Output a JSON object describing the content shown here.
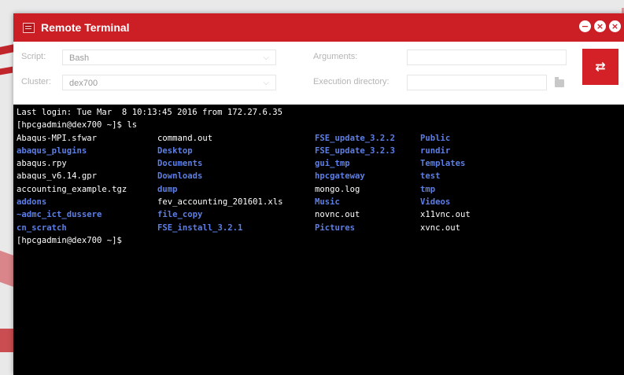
{
  "window": {
    "title": "Remote Terminal",
    "controls": [
      "−",
      "×",
      "×"
    ]
  },
  "form": {
    "script_label": "Script:",
    "script_value": "Bash",
    "cluster_label": "Cluster:",
    "cluster_value": "dex700",
    "arguments_label": "Arguments:",
    "arguments_value": "",
    "execdir_label": "Execution directory:",
    "execdir_value": "",
    "run_icon": "⇄"
  },
  "colors": {
    "accent": "#cc1f25",
    "directory": "#5d7fe5",
    "archive": "#e02b2b"
  },
  "terminal": {
    "last_login": "Last login: Tue Mar  8 10:13:45 2016 from 172.27.6.35",
    "prompt_cmd": "[hpcgadmin@dex700 ~]$ ls",
    "prompt_end": "[hpcgadmin@dex700 ~]$ ",
    "ls_rows": [
      [
        {
          "name": "Abaqus-MPI.sfwar",
          "type": "file"
        },
        {
          "name": "command.out",
          "type": "file"
        },
        {
          "name": "FSE_update_3.2.2",
          "type": "dir"
        },
        {
          "name": "Public",
          "type": "dir"
        }
      ],
      [
        {
          "name": "abaqus_plugins",
          "type": "dir"
        },
        {
          "name": "Desktop",
          "type": "dir"
        },
        {
          "name": "FSE_update_3.2.3",
          "type": "dir"
        },
        {
          "name": "rundir",
          "type": "dir"
        }
      ],
      [
        {
          "name": "abaqus.rpy",
          "type": "file"
        },
        {
          "name": "Documents",
          "type": "dir"
        },
        {
          "name": "gui_tmp",
          "type": "dir"
        },
        {
          "name": "Templates",
          "type": "dir"
        }
      ],
      [
        {
          "name": "abaqus_v6.14.gpr",
          "type": "file"
        },
        {
          "name": "Downloads",
          "type": "dir"
        },
        {
          "name": "hpcgateway",
          "type": "dir"
        },
        {
          "name": "test",
          "type": "dir"
        }
      ],
      [
        {
          "name": "accounting_example.tgz",
          "type": "archive"
        },
        {
          "name": "dump",
          "type": "dir"
        },
        {
          "name": "mongo.log",
          "type": "file"
        },
        {
          "name": "tmp",
          "type": "dir"
        }
      ],
      [
        {
          "name": "addons",
          "type": "dir"
        },
        {
          "name": "fev_accounting_201601.xls",
          "type": "file"
        },
        {
          "name": "Music",
          "type": "dir"
        },
        {
          "name": "Videos",
          "type": "dir"
        }
      ],
      [
        {
          "name": "~admc_ict_dussere",
          "type": "dir"
        },
        {
          "name": "file_copy",
          "type": "dir"
        },
        {
          "name": "novnc.out",
          "type": "file"
        },
        {
          "name": "x11vnc.out",
          "type": "file"
        }
      ],
      [
        {
          "name": "cn_scratch",
          "type": "dir"
        },
        {
          "name": "FSE_install_3.2.1",
          "type": "dir"
        },
        {
          "name": "Pictures",
          "type": "dir"
        },
        {
          "name": "xvnc.out",
          "type": "file"
        }
      ]
    ]
  }
}
